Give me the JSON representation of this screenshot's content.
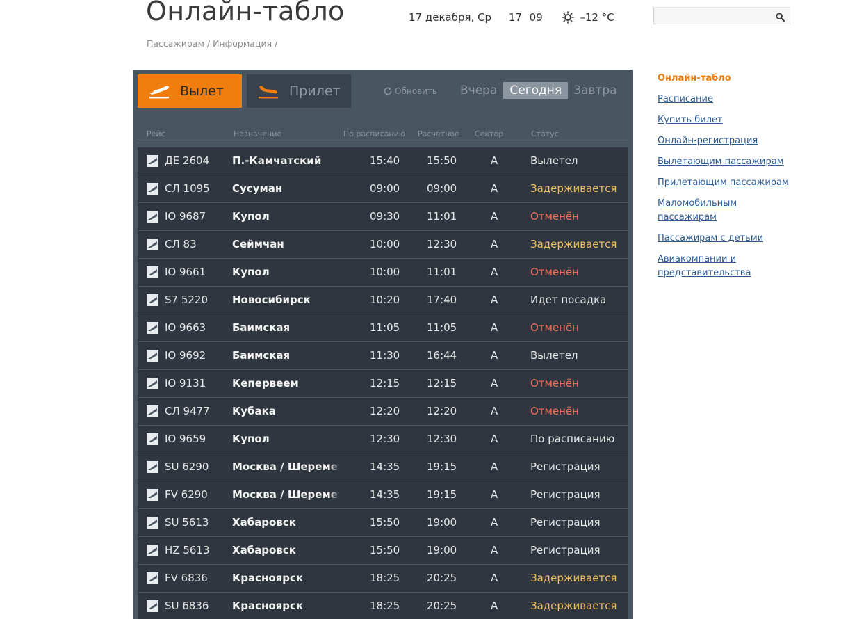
{
  "page": {
    "title": "Онлайн-табло",
    "date": "17 декабря, Ср",
    "time": "17 09",
    "weather": "–12 °C",
    "breadcrumb": [
      "Пассажирам",
      "Информация"
    ],
    "breadcrumb_sep": "/"
  },
  "search": {
    "placeholder": ""
  },
  "board": {
    "tabs": {
      "departures": "Вылет",
      "arrivals": "Прилет"
    },
    "refresh": "Обновить",
    "days": [
      "Вчера",
      "Сегодня",
      "Завтра"
    ],
    "columns": {
      "flight": "Рейс",
      "destination": "Назначение",
      "scheduled": "По расписанию",
      "estimated": "Расчетное",
      "sector": "Сектор",
      "status": "Статус"
    },
    "rows": [
      {
        "logo": "airline-logo-icon",
        "flight": "ДЕ 2604",
        "dest": "П.-Камчатский",
        "sched": "15:40",
        "est": "15:50",
        "sector": "A",
        "status": "Вылетел",
        "type": "normal"
      },
      {
        "logo": "airline-logo-icon",
        "flight": "СЛ 1095",
        "dest": "Сусуман",
        "sched": "09:00",
        "est": "09:00",
        "sector": "A",
        "status": "Задерживается",
        "type": "delay"
      },
      {
        "logo": "airline-logo-icon",
        "flight": "IO 9687",
        "dest": "Купол",
        "sched": "09:30",
        "est": "11:01",
        "sector": "A",
        "status": "Отменён",
        "type": "cancel"
      },
      {
        "logo": "airline-logo-icon",
        "flight": "СЛ 83",
        "dest": "Сеймчан",
        "sched": "10:00",
        "est": "12:30",
        "sector": "A",
        "status": "Задерживается",
        "type": "delay"
      },
      {
        "logo": "airline-logo-icon",
        "flight": "IO 9661",
        "dest": "Купол",
        "sched": "10:00",
        "est": "11:01",
        "sector": "A",
        "status": "Отменён",
        "type": "cancel"
      },
      {
        "logo": "airline-logo-icon",
        "flight": "S7 5220",
        "dest": "Новосибирск",
        "sched": "10:20",
        "est": "17:40",
        "sector": "A",
        "status": "Идет посадка",
        "type": "normal"
      },
      {
        "logo": "airline-logo-icon",
        "flight": "IO 9663",
        "dest": "Баимская",
        "sched": "11:05",
        "est": "11:05",
        "sector": "A",
        "status": "Отменён",
        "type": "cancel"
      },
      {
        "logo": "airline-logo-icon",
        "flight": "IO 9692",
        "dest": "Баимская",
        "sched": "11:30",
        "est": "16:44",
        "sector": "A",
        "status": "Вылетел",
        "type": "normal"
      },
      {
        "logo": "airline-logo-icon",
        "flight": "IO 9131",
        "dest": "Кепервеем",
        "sched": "12:15",
        "est": "12:15",
        "sector": "A",
        "status": "Отменён",
        "type": "cancel"
      },
      {
        "logo": "airline-logo-icon",
        "flight": "СЛ 9477",
        "dest": "Кубака",
        "sched": "12:20",
        "est": "12:20",
        "sector": "A",
        "status": "Отменён",
        "type": "cancel"
      },
      {
        "logo": "airline-logo-icon",
        "flight": "IO 9659",
        "dest": "Купол",
        "sched": "12:30",
        "est": "12:30",
        "sector": "A",
        "status": "По расписанию",
        "type": "normal"
      },
      {
        "logo": "airline-logo-icon",
        "flight": "SU 6290",
        "dest": "Москва / Шереметь",
        "sched": "14:35",
        "est": "19:15",
        "sector": "A",
        "status": "Регистрация",
        "type": "normal"
      },
      {
        "logo": "airline-logo-icon",
        "flight": "FV 6290",
        "dest": "Москва / Шереметь",
        "sched": "14:35",
        "est": "19:15",
        "sector": "A",
        "status": "Регистрация",
        "type": "normal"
      },
      {
        "logo": "airline-logo-icon",
        "flight": "SU 5613",
        "dest": "Хабаровск",
        "sched": "15:50",
        "est": "19:00",
        "sector": "A",
        "status": "Регистрация",
        "type": "normal"
      },
      {
        "logo": "airline-logo-icon",
        "flight": "HZ 5613",
        "dest": "Хабаровск",
        "sched": "15:50",
        "est": "19:00",
        "sector": "A",
        "status": "Регистрация",
        "type": "normal"
      },
      {
        "logo": "airline-logo-icon",
        "flight": "FV 6836",
        "dest": "Красноярск",
        "sched": "18:25",
        "est": "20:25",
        "sector": "A",
        "status": "Задерживается",
        "type": "delay"
      },
      {
        "logo": "airline-logo-icon",
        "flight": "SU 6836",
        "dest": "Красноярск",
        "sched": "18:25",
        "est": "20:25",
        "sector": "A",
        "status": "Задерживается",
        "type": "delay"
      }
    ]
  },
  "sidebar": {
    "items": [
      {
        "label": "Онлайн-табло",
        "active": true
      },
      {
        "label": "Расписание",
        "active": false
      },
      {
        "label": "Купить билет",
        "active": false
      },
      {
        "label": "Онлайн-регистрация",
        "active": false
      },
      {
        "label": "Вылетающим пассажирам",
        "active": false
      },
      {
        "label": "Прилетающим пассажирам",
        "active": false
      },
      {
        "label": "Маломобильным пассажирам",
        "active": false
      },
      {
        "label": "Пассажирам с детьми",
        "active": false
      },
      {
        "label": "Авиакомпании и представительства",
        "active": false
      }
    ]
  },
  "colors": {
    "accent": "#f07e0f",
    "board_bg": "#4a5562",
    "row_bg": "#2f363f",
    "status_delay": "#f0c15a",
    "status_cancel": "#f0715f",
    "link": "#2b5a92"
  }
}
